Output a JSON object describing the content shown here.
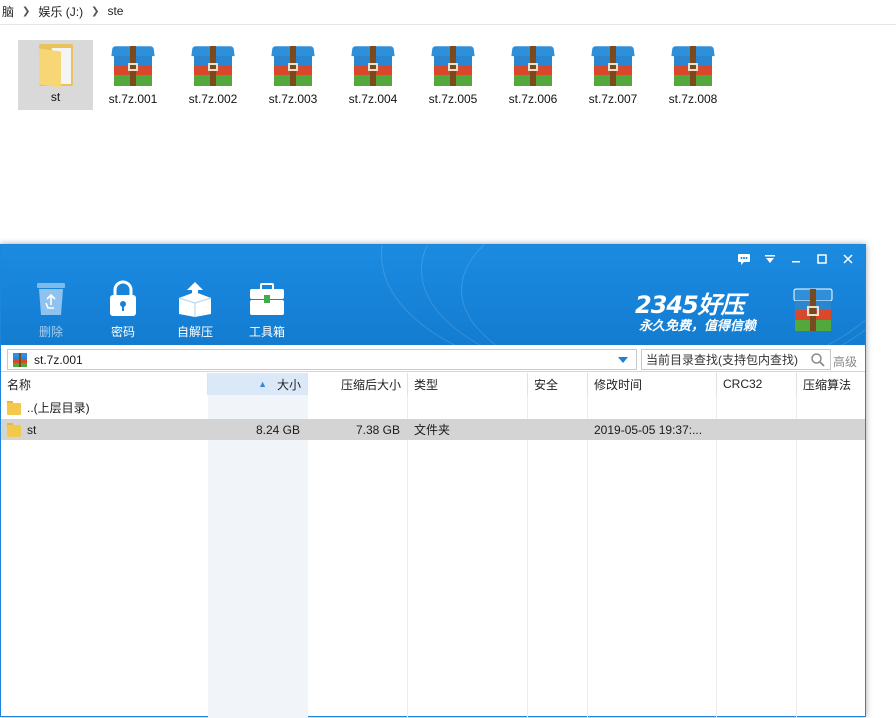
{
  "explorer": {
    "breadcrumb": [
      "脑",
      "娱乐 (J:)",
      "ste"
    ],
    "files": [
      {
        "name": "st",
        "type": "folder",
        "selected": true
      },
      {
        "name": "st.7z.001",
        "type": "archive"
      },
      {
        "name": "st.7z.002",
        "type": "archive"
      },
      {
        "name": "st.7z.003",
        "type": "archive"
      },
      {
        "name": "st.7z.004",
        "type": "archive"
      },
      {
        "name": "st.7z.005",
        "type": "archive"
      },
      {
        "name": "st.7z.006",
        "type": "archive"
      },
      {
        "name": "st.7z.007",
        "type": "archive"
      },
      {
        "name": "st.7z.008",
        "type": "archive"
      }
    ]
  },
  "app": {
    "toolbar": {
      "delete": "删除",
      "password": "密码",
      "self_extract": "自解压",
      "toolbox": "工具箱"
    },
    "brand": {
      "title": "2345好压",
      "subtitle": "永久免费，值得信赖"
    },
    "address": {
      "path": "st.7z.001"
    },
    "search": {
      "placeholder": "当前目录查找(支持包内查找)",
      "advanced": "高级"
    },
    "columns": {
      "name": "名称",
      "size": "大小",
      "packed": "压缩后大小",
      "type": "类型",
      "security": "安全",
      "modified": "修改时间",
      "crc": "CRC32",
      "method": "压缩算法"
    },
    "rows": [
      {
        "name": "..(上层目录)",
        "size": "",
        "packed": "",
        "type": "",
        "security": "",
        "modified": "",
        "crc": "",
        "method": ""
      },
      {
        "name": "st",
        "size": "8.24 GB",
        "packed": "7.38 GB",
        "type": "文件夹",
        "security": "",
        "modified": "2019-05-05 19:37:...",
        "crc": "",
        "method": ""
      }
    ]
  },
  "colors": {
    "header_blue": "#1682d8",
    "selection_gray": "#d4d4d4"
  }
}
